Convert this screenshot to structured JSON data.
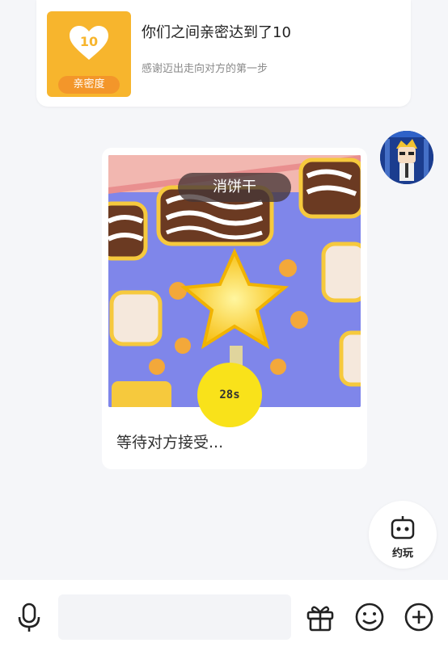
{
  "intimacy": {
    "level": "10",
    "badge_label": "亲密度",
    "title": "你们之间亲密达到了10",
    "subtitle": "感谢迈出走向对方的第一步"
  },
  "game_invite": {
    "game_name": "消饼干",
    "countdown": "28s",
    "status_text": "等待对方接受..."
  },
  "play_button": {
    "label": "约玩"
  },
  "input_bar": {
    "placeholder": ""
  },
  "icons": {
    "mic": "microphone-icon",
    "gift": "gift-icon",
    "emoji": "emoji-icon",
    "plus": "plus-icon",
    "play": "game-robot-icon"
  },
  "colors": {
    "badge_yellow": "#f7b52d",
    "timer_yellow": "#f9e21a",
    "background": "#f5f6f9"
  }
}
